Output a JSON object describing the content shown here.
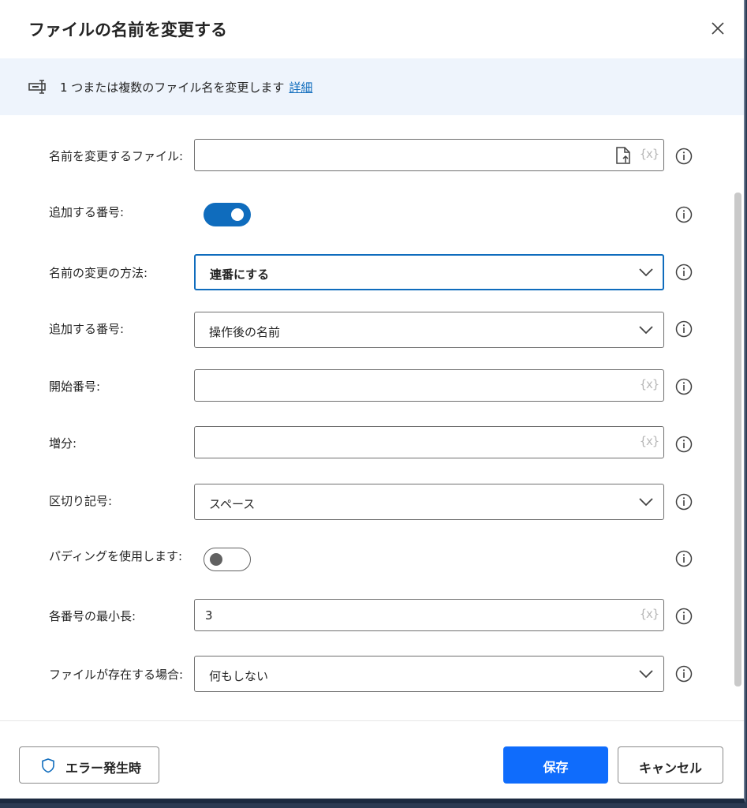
{
  "dialog": {
    "title": "ファイルの名前を変更する",
    "close_icon": "close-icon"
  },
  "info": {
    "icon": "rename-file-icon",
    "text": "1 つまたは複数のファイル名を変更します",
    "link": "詳細"
  },
  "form": {
    "file_to_rename": {
      "label": "名前を変更するファイル:",
      "value": "",
      "icons": [
        "file-picker-icon",
        "variable-icon"
      ],
      "var_text": "{x}"
    },
    "add_number_toggle": {
      "label": "追加する番号:",
      "state": "on"
    },
    "rename_method": {
      "label": "名前の変更の方法:",
      "value": "連番にする"
    },
    "add_number_position": {
      "label": "追加する番号:",
      "value": "操作後の名前"
    },
    "start_number": {
      "label": "開始番号:",
      "value": "",
      "var_text": "{x}"
    },
    "increment": {
      "label": "増分:",
      "value": "",
      "var_text": "{x}"
    },
    "separator": {
      "label": "区切り記号:",
      "value": "スペース"
    },
    "use_padding": {
      "label": "パディングを使用します:",
      "state": "off"
    },
    "min_length": {
      "label": "各番号の最小長:",
      "value": "3",
      "var_text": "{x}"
    },
    "if_file_exists": {
      "label": "ファイルが存在する場合:",
      "value": "何もしない"
    }
  },
  "footer": {
    "on_error_label": "エラー発生時",
    "save_label": "保存",
    "cancel_label": "キャンセル"
  },
  "colors": {
    "accent": "#0f6cbd",
    "save_button": "#0f6cfc",
    "info_bar": "#eef4fc"
  }
}
